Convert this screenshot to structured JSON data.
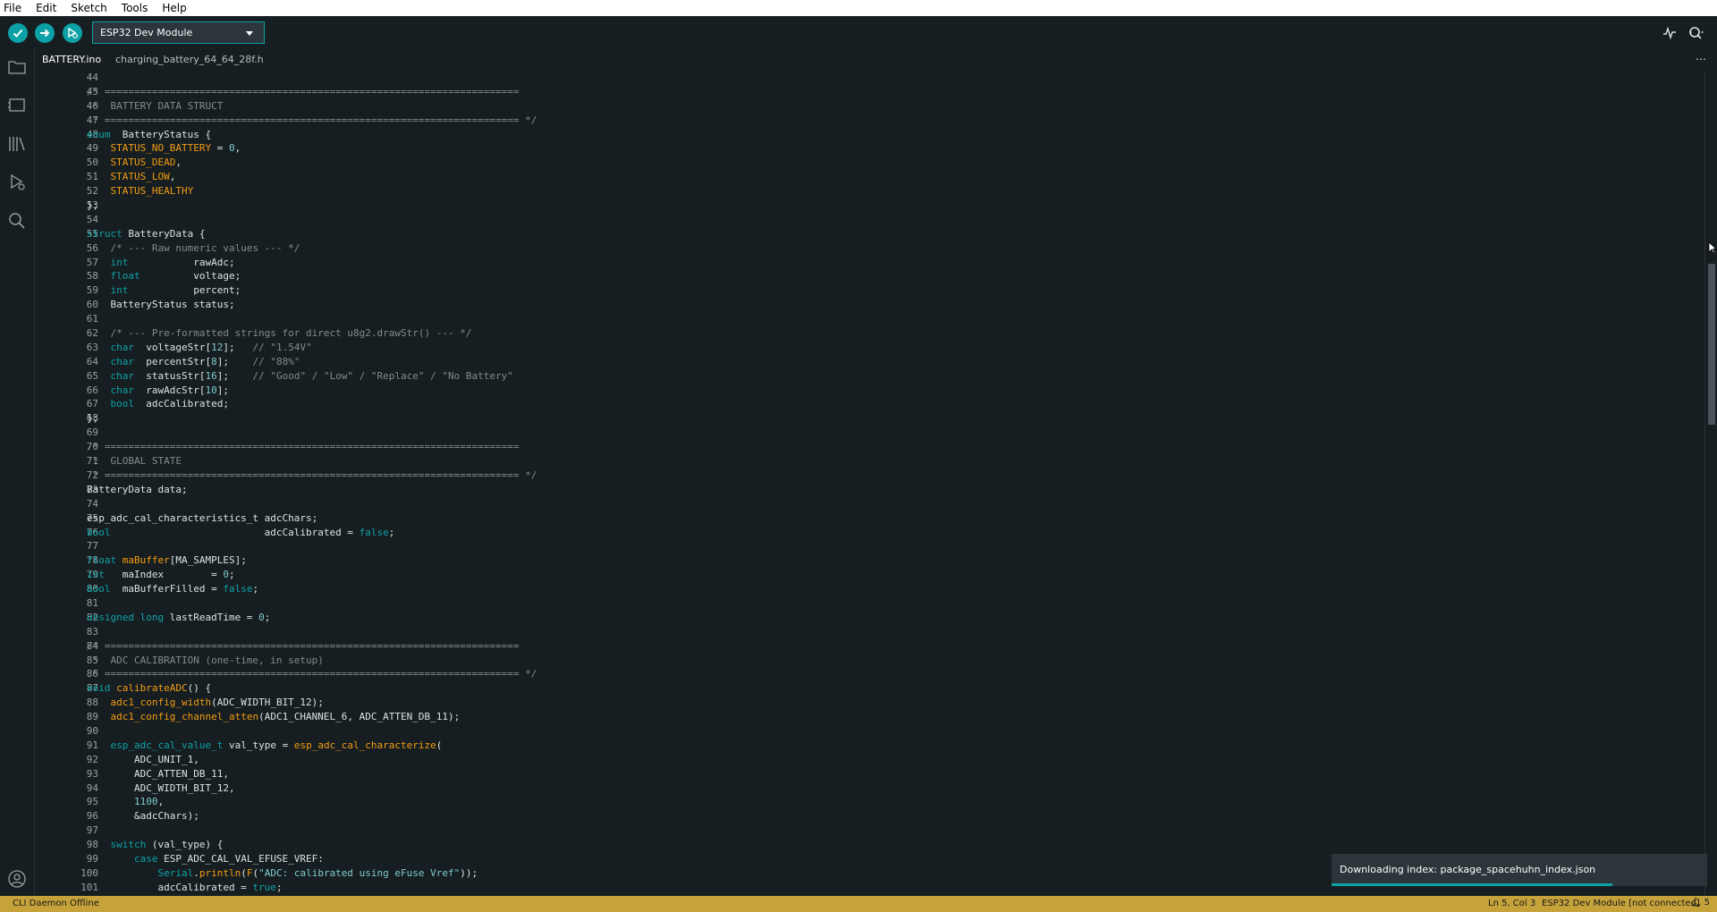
{
  "menu": [
    "File",
    "Edit",
    "Sketch",
    "Tools",
    "Help"
  ],
  "board_select": "ESP32 Dev Module",
  "tabs": [
    "BATTERY.ino",
    "charging_battery_64_64_28f.h"
  ],
  "tab_more": "⋯",
  "code_lines": [
    {
      "n": "44",
      "t": []
    },
    {
      "n": "45",
      "t": [
        [
          "c",
          "/* ======================================================================"
        ]
      ]
    },
    {
      "n": "46",
      "t": [
        [
          "c",
          " *  BATTERY DATA STRUCT"
        ]
      ]
    },
    {
      "n": "47",
      "t": [
        [
          "c",
          " * ====================================================================== */"
        ]
      ]
    },
    {
      "n": "48",
      "t": [
        [
          "kw",
          "enum"
        ],
        [
          "",
          "  BatteryStatus {"
        ]
      ]
    },
    {
      "n": "49",
      "t": [
        [
          "",
          "    "
        ],
        [
          "or",
          "STATUS_NO_BATTERY"
        ],
        [
          "",
          " = "
        ],
        [
          "num",
          "0"
        ],
        [
          "",
          ","
        ]
      ]
    },
    {
      "n": "50",
      "t": [
        [
          "",
          "    "
        ],
        [
          "or",
          "STATUS_DEAD"
        ],
        [
          "",
          ","
        ]
      ]
    },
    {
      "n": "51",
      "t": [
        [
          "",
          "    "
        ],
        [
          "or",
          "STATUS_LOW"
        ],
        [
          "",
          ","
        ]
      ]
    },
    {
      "n": "52",
      "t": [
        [
          "",
          "    "
        ],
        [
          "or",
          "STATUS_HEALTHY"
        ]
      ]
    },
    {
      "n": "53",
      "t": [
        [
          "",
          "};"
        ]
      ]
    },
    {
      "n": "54",
      "t": []
    },
    {
      "n": "55",
      "t": [
        [
          "kw",
          "struct"
        ],
        [
          "",
          " BatteryData {"
        ]
      ]
    },
    {
      "n": "56",
      "t": [
        [
          "",
          "    "
        ],
        [
          "c",
          "/* --- Raw numeric values --- */"
        ]
      ]
    },
    {
      "n": "57",
      "t": [
        [
          "",
          "    "
        ],
        [
          "kw",
          "int"
        ],
        [
          "",
          "           rawAdc;"
        ]
      ]
    },
    {
      "n": "58",
      "t": [
        [
          "",
          "    "
        ],
        [
          "kw",
          "float"
        ],
        [
          "",
          "         voltage;"
        ]
      ]
    },
    {
      "n": "59",
      "t": [
        [
          "",
          "    "
        ],
        [
          "kw",
          "int"
        ],
        [
          "",
          "           percent;"
        ]
      ]
    },
    {
      "n": "60",
      "t": [
        [
          "",
          "    BatteryStatus status;"
        ]
      ]
    },
    {
      "n": "61",
      "t": []
    },
    {
      "n": "62",
      "t": [
        [
          "",
          "    "
        ],
        [
          "c",
          "/* --- Pre-formatted strings for direct u8g2.drawStr() --- */"
        ]
      ]
    },
    {
      "n": "63",
      "t": [
        [
          "",
          "    "
        ],
        [
          "kw",
          "char"
        ],
        [
          "",
          "  voltageStr["
        ],
        [
          "num",
          "12"
        ],
        [
          "",
          "];   "
        ],
        [
          "c",
          "// \"1.54V\""
        ]
      ]
    },
    {
      "n": "64",
      "t": [
        [
          "",
          "    "
        ],
        [
          "kw",
          "char"
        ],
        [
          "",
          "  percentStr["
        ],
        [
          "num",
          "8"
        ],
        [
          "",
          "];    "
        ],
        [
          "c",
          "// \"88%\""
        ]
      ]
    },
    {
      "n": "65",
      "t": [
        [
          "",
          "    "
        ],
        [
          "kw",
          "char"
        ],
        [
          "",
          "  statusStr["
        ],
        [
          "num",
          "16"
        ],
        [
          "",
          "];    "
        ],
        [
          "c",
          "// \"Good\" / \"Low\" / \"Replace\" / \"No Battery\""
        ]
      ]
    },
    {
      "n": "66",
      "t": [
        [
          "",
          "    "
        ],
        [
          "kw",
          "char"
        ],
        [
          "",
          "  rawAdcStr["
        ],
        [
          "num",
          "10"
        ],
        [
          "",
          "];"
        ]
      ]
    },
    {
      "n": "67",
      "t": [
        [
          "",
          "    "
        ],
        [
          "kw",
          "bool"
        ],
        [
          "",
          "  adcCalibrated;"
        ]
      ]
    },
    {
      "n": "68",
      "t": [
        [
          "",
          "};"
        ]
      ]
    },
    {
      "n": "69",
      "t": []
    },
    {
      "n": "70",
      "t": [
        [
          "c",
          "/* ======================================================================"
        ]
      ]
    },
    {
      "n": "71",
      "t": [
        [
          "c",
          " *  GLOBAL STATE"
        ]
      ]
    },
    {
      "n": "72",
      "t": [
        [
          "c",
          " * ====================================================================== */"
        ]
      ]
    },
    {
      "n": "73",
      "t": [
        [
          "",
          "BatteryData data;"
        ]
      ]
    },
    {
      "n": "74",
      "t": []
    },
    {
      "n": "75",
      "t": [
        [
          "",
          "esp_adc_cal_characteristics_t adcChars;"
        ]
      ]
    },
    {
      "n": "76",
      "t": [
        [
          "kw",
          "bool"
        ],
        [
          "",
          "                          adcCalibrated = "
        ],
        [
          "kw",
          "false"
        ],
        [
          "",
          ";"
        ]
      ]
    },
    {
      "n": "77",
      "t": []
    },
    {
      "n": "78",
      "t": [
        [
          "kw",
          "float"
        ],
        [
          "or",
          " maBuffer"
        ],
        [
          "",
          "[MA_SAMPLES];"
        ]
      ]
    },
    {
      "n": "79",
      "t": [
        [
          "kw",
          "int"
        ],
        [
          "",
          "   maIndex        = "
        ],
        [
          "num",
          "0"
        ],
        [
          "",
          ";"
        ]
      ]
    },
    {
      "n": "80",
      "t": [
        [
          "kw",
          "bool"
        ],
        [
          "",
          "  maBufferFilled = "
        ],
        [
          "kw",
          "false"
        ],
        [
          "",
          ";"
        ]
      ]
    },
    {
      "n": "81",
      "t": []
    },
    {
      "n": "82",
      "t": [
        [
          "kw",
          "unsigned long"
        ],
        [
          "",
          " lastReadTime = "
        ],
        [
          "num",
          "0"
        ],
        [
          "",
          ";"
        ]
      ]
    },
    {
      "n": "83",
      "t": []
    },
    {
      "n": "84",
      "t": [
        [
          "c",
          "/* ======================================================================"
        ]
      ]
    },
    {
      "n": "85",
      "t": [
        [
          "c",
          " *  ADC CALIBRATION (one-time, in setup)"
        ]
      ]
    },
    {
      "n": "86",
      "t": [
        [
          "c",
          " * ====================================================================== */"
        ]
      ]
    },
    {
      "n": "87",
      "t": [
        [
          "kw",
          "void"
        ],
        [
          "or",
          " calibrateADC"
        ],
        [
          "",
          "() {"
        ]
      ]
    },
    {
      "n": "88",
      "t": [
        [
          "",
          "    "
        ],
        [
          "or",
          "adc1_config_width"
        ],
        [
          "",
          "(ADC_WIDTH_BIT_12);"
        ]
      ]
    },
    {
      "n": "89",
      "t": [
        [
          "",
          "    "
        ],
        [
          "or",
          "adc1_config_channel_atten"
        ],
        [
          "",
          "(ADC1_CHANNEL_6, ADC_ATTEN_DB_11);"
        ]
      ]
    },
    {
      "n": "90",
      "t": []
    },
    {
      "n": "91",
      "t": [
        [
          "",
          "    "
        ],
        [
          "kw",
          "esp_adc_cal_value_t"
        ],
        [
          "",
          " val_type = "
        ],
        [
          "or",
          "esp_adc_cal_characterize"
        ],
        [
          "",
          "("
        ]
      ]
    },
    {
      "n": "92",
      "t": [
        [
          "",
          "        ADC_UNIT_1,"
        ]
      ]
    },
    {
      "n": "93",
      "t": [
        [
          "",
          "        ADC_ATTEN_DB_11,"
        ]
      ]
    },
    {
      "n": "94",
      "t": [
        [
          "",
          "        ADC_WIDTH_BIT_12,"
        ]
      ]
    },
    {
      "n": "95",
      "t": [
        [
          "",
          "        "
        ],
        [
          "num",
          "1100"
        ],
        [
          "",
          ","
        ]
      ]
    },
    {
      "n": "96",
      "t": [
        [
          "",
          "        &adcChars);"
        ]
      ]
    },
    {
      "n": "97",
      "t": []
    },
    {
      "n": "98",
      "t": [
        [
          "",
          "    "
        ],
        [
          "kw",
          "switch"
        ],
        [
          "",
          " (val_type) {"
        ]
      ]
    },
    {
      "n": "99",
      "t": [
        [
          "",
          "        "
        ],
        [
          "kw",
          "case"
        ],
        [
          "",
          " ESP_ADC_CAL_VAL_EFUSE_VREF:"
        ]
      ]
    },
    {
      "n": "100",
      "t": [
        [
          "",
          "            "
        ],
        [
          "kw",
          "Serial"
        ],
        [
          "",
          "."
        ],
        [
          "or",
          "println"
        ],
        [
          "",
          "("
        ],
        [
          "or",
          "F"
        ],
        [
          "",
          "("
        ],
        [
          "str",
          "\"ADC: calibrated using eFuse Vref\""
        ],
        [
          "",
          "));"
        ]
      ]
    },
    {
      "n": "101",
      "t": [
        [
          "",
          "            adcCalibrated = "
        ],
        [
          "kw",
          "true"
        ],
        [
          "",
          ";"
        ]
      ]
    }
  ],
  "notification": "Downloading index: package_spacehuhn_index.json",
  "status": {
    "left": "CLI Daemon Offline",
    "position": "Ln 5, Col 3",
    "board": "ESP32 Dev Module [not connected]",
    "notif_count": "5"
  }
}
